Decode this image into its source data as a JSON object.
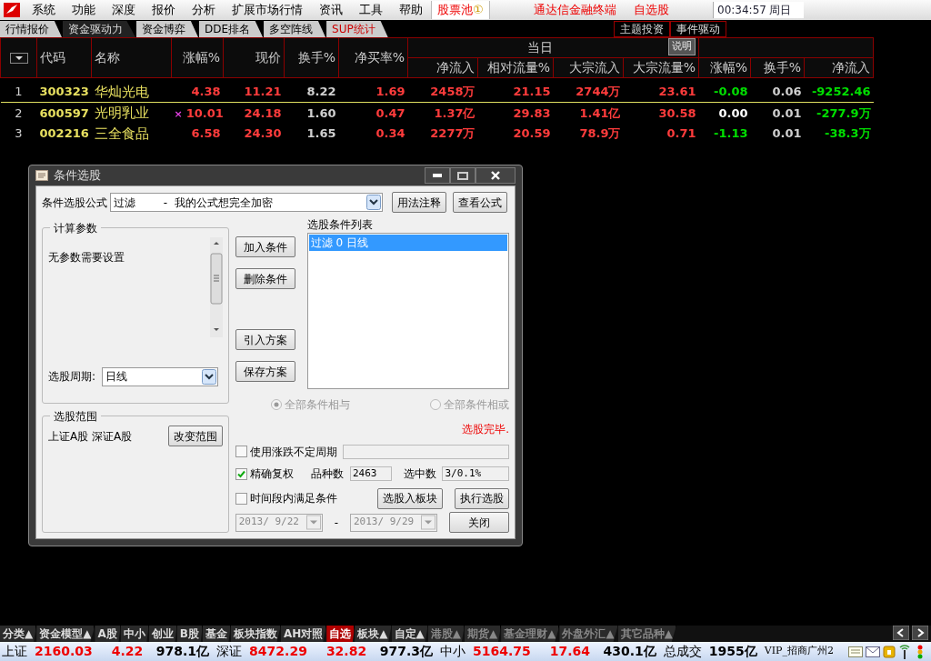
{
  "menu": {
    "items": [
      "系统",
      "功能",
      "深度",
      "报价",
      "分析",
      "扩展市场行情",
      "资讯",
      "工具",
      "帮助"
    ],
    "pool": "股票池",
    "pool_badge": "①",
    "title": "通达信金融终端",
    "subtitle": "自选股",
    "time": "00:34:57",
    "weekday": "周日"
  },
  "tabs": [
    {
      "label": "行情报价",
      "selected": false,
      "accent": false
    },
    {
      "label": "资金驱动力",
      "selected": true,
      "accent": false
    },
    {
      "label": "资金博弈",
      "selected": false,
      "accent": false
    },
    {
      "label": "DDE排名",
      "selected": false,
      "accent": false
    },
    {
      "label": "多空阵线",
      "selected": false,
      "accent": false
    },
    {
      "label": "SUP统计",
      "selected": false,
      "accent": true
    }
  ],
  "right_tabs": [
    "主题投资",
    "事件驱动"
  ],
  "table": {
    "group": "当日",
    "group_button": "说明",
    "columns": [
      "代码",
      "名称",
      "涨幅%",
      "现价",
      "换手%",
      "净买率%",
      "净流入",
      "相对流量%",
      "大宗流入",
      "大宗流量%",
      "涨幅%",
      "换手%",
      "净流入"
    ],
    "rows": [
      {
        "index": "1",
        "selected": true,
        "flag": "",
        "cells": [
          {
            "text": "300323",
            "color": "#e8e060"
          },
          {
            "text": "华灿光电",
            "color": "#e8e060"
          },
          {
            "text": "4.38",
            "color": "#ff3c3c"
          },
          {
            "text": "11.21",
            "color": "#ff3c3c"
          },
          {
            "text": "8.22",
            "color": "#d0d0d0"
          },
          {
            "text": "1.69",
            "color": "#ff3c3c"
          },
          {
            "text": "2458万",
            "color": "#ff3c3c"
          },
          {
            "text": "21.15",
            "color": "#ff3c3c"
          },
          {
            "text": "2744万",
            "color": "#ff3c3c"
          },
          {
            "text": "23.61",
            "color": "#ff3c3c"
          },
          {
            "text": "-0.08",
            "color": "#00e000"
          },
          {
            "text": "0.06",
            "color": "#d0d0d0"
          },
          {
            "text": "-9252.46",
            "color": "#00e000"
          }
        ]
      },
      {
        "index": "2",
        "selected": false,
        "flag": "×",
        "cells": [
          {
            "text": "600597",
            "color": "#e8e060"
          },
          {
            "text": "光明乳业",
            "color": "#e8e060"
          },
          {
            "text": "10.01",
            "color": "#ff3c3c"
          },
          {
            "text": "24.18",
            "color": "#ff3c3c"
          },
          {
            "text": "1.60",
            "color": "#d0d0d0"
          },
          {
            "text": "0.47",
            "color": "#ff3c3c"
          },
          {
            "text": "1.37亿",
            "color": "#ff3c3c"
          },
          {
            "text": "29.83",
            "color": "#ff3c3c"
          },
          {
            "text": "1.41亿",
            "color": "#ff3c3c"
          },
          {
            "text": "30.58",
            "color": "#ff3c3c"
          },
          {
            "text": "0.00",
            "color": "#ffffff"
          },
          {
            "text": "0.01",
            "color": "#d0d0d0"
          },
          {
            "text": "-277.9万",
            "color": "#00e000"
          }
        ]
      },
      {
        "index": "3",
        "selected": false,
        "flag": "",
        "cells": [
          {
            "text": "002216",
            "color": "#e8e060"
          },
          {
            "text": "三全食品",
            "color": "#e8e060"
          },
          {
            "text": "6.58",
            "color": "#ff3c3c"
          },
          {
            "text": "24.30",
            "color": "#ff3c3c"
          },
          {
            "text": "1.65",
            "color": "#d0d0d0"
          },
          {
            "text": "0.34",
            "color": "#ff3c3c"
          },
          {
            "text": "2277万",
            "color": "#ff3c3c"
          },
          {
            "text": "20.59",
            "color": "#ff3c3c"
          },
          {
            "text": "78.9万",
            "color": "#ff3c3c"
          },
          {
            "text": "0.71",
            "color": "#ff3c3c"
          },
          {
            "text": "-1.13",
            "color": "#00e000"
          },
          {
            "text": "0.01",
            "color": "#d0d0d0"
          },
          {
            "text": "-38.3万",
            "color": "#00e000"
          }
        ]
      }
    ]
  },
  "dialog": {
    "title": "条件选股",
    "formula_label": "条件选股公式",
    "formula_value": "过滤        -  我的公式想完全加密",
    "usage_button": "用法注释",
    "view_button": "查看公式",
    "params_title": "计算参数",
    "params_text": "无参数需要设置",
    "period_label": "选股周期:",
    "period_value": "日线",
    "scope_title": "选股范围",
    "scope_text": "上证A股 深证A股",
    "scope_button": "改变范围",
    "middle_buttons": [
      "加入条件",
      "删除条件",
      "引入方案",
      "保存方案"
    ],
    "list_title": "选股条件列表",
    "conditions": [
      {
        "text": "过滤  0  日线",
        "selected": true
      }
    ],
    "radios": [
      {
        "label": "全部条件相与",
        "selected": true
      },
      {
        "label": "全部条件相或",
        "selected": false
      }
    ],
    "status": "选股完毕.",
    "use_period": {
      "label": "使用涨跌不定周期",
      "checked": false
    },
    "adjust": {
      "label": "精确复权",
      "checked": true
    },
    "count_label": "品种数",
    "count_value": "2463",
    "picked_label": "选中数",
    "picked_value": "3/0.1%",
    "in_range": {
      "label": "时间段内满足条件",
      "checked": false
    },
    "to_block_button": "选股入板块",
    "run_button": "执行选股",
    "date_from": "2013/ 9/22",
    "date_sep": "-",
    "date_to": "2013/ 9/29",
    "close_button": "关闭"
  },
  "bottom_tabs": [
    {
      "label": "分类▲",
      "selected": false,
      "dimmed": false
    },
    {
      "label": "资金模型▲",
      "selected": false,
      "dimmed": false
    },
    {
      "label": "A股",
      "selected": false,
      "dimmed": false
    },
    {
      "label": "中小",
      "selected": false,
      "dimmed": false
    },
    {
      "label": "创业",
      "selected": false,
      "dimmed": false
    },
    {
      "label": "B股",
      "selected": false,
      "dimmed": false
    },
    {
      "label": "基金",
      "selected": false,
      "dimmed": false
    },
    {
      "label": "板块指数",
      "selected": false,
      "dimmed": false
    },
    {
      "label": "AH对照",
      "selected": false,
      "dimmed": false
    },
    {
      "label": "自选",
      "selected": true,
      "dimmed": false
    },
    {
      "label": "板块▲",
      "selected": false,
      "dimmed": false
    },
    {
      "label": "自定▲",
      "selected": false,
      "dimmed": false
    },
    {
      "label": "港股▲",
      "selected": false,
      "dimmed": true
    },
    {
      "label": "期货▲",
      "selected": false,
      "dimmed": true
    },
    {
      "label": "基金理财▲",
      "selected": false,
      "dimmed": true
    },
    {
      "label": "外盘外汇▲",
      "selected": false,
      "dimmed": true
    },
    {
      "label": "其它品种▲",
      "selected": false,
      "dimmed": true
    }
  ],
  "status_bar": {
    "indices": [
      {
        "name": "上证",
        "value": "2160.03",
        "change": "4.22",
        "amount": "978.1亿"
      },
      {
        "name": "深证",
        "value": "8472.29",
        "change": "32.82",
        "amount": "977.3亿"
      },
      {
        "name": "中小",
        "value": "5164.75",
        "change": "17.64",
        "amount": "430.1亿"
      }
    ],
    "total_label": "总成交",
    "total_value": "1955亿",
    "server": "VIP_招商广州2"
  }
}
